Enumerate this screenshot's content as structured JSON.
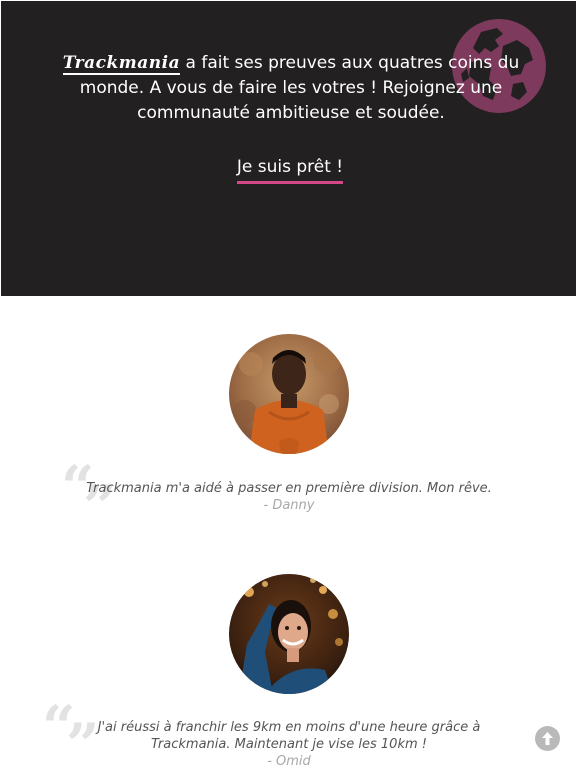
{
  "hero": {
    "brand": "Trackmania",
    "text_line1": " a fait ses preuves aux quatres coins du monde. A vous de faire les votres ! Rejoignez une communauté ambitieuse et soudée.",
    "cta_label": "Je suis prêt !",
    "background_color": "#222020",
    "globe_icon": "globe-icon",
    "globe_color": "#7d3a5c"
  },
  "testimonials": [
    {
      "quote": "Trackmania m'a aidé à passer en première division. Mon rêve.",
      "author": "- Danny"
    },
    {
      "quote_line1": "J'ai réussi à franchir les 9km en moins d'une heure grâce à",
      "quote_line2": "Trackmania. Maintenant je vise les 10km !",
      "author": "- Omid"
    }
  ],
  "quote_mark_open": "“",
  "quote_mark_close": "”",
  "scroll_top": {
    "icon": "arrow-up-icon"
  },
  "colors": {
    "accent": "#d6478a",
    "quote_text": "#555555",
    "author_text": "#a8a8a8"
  }
}
